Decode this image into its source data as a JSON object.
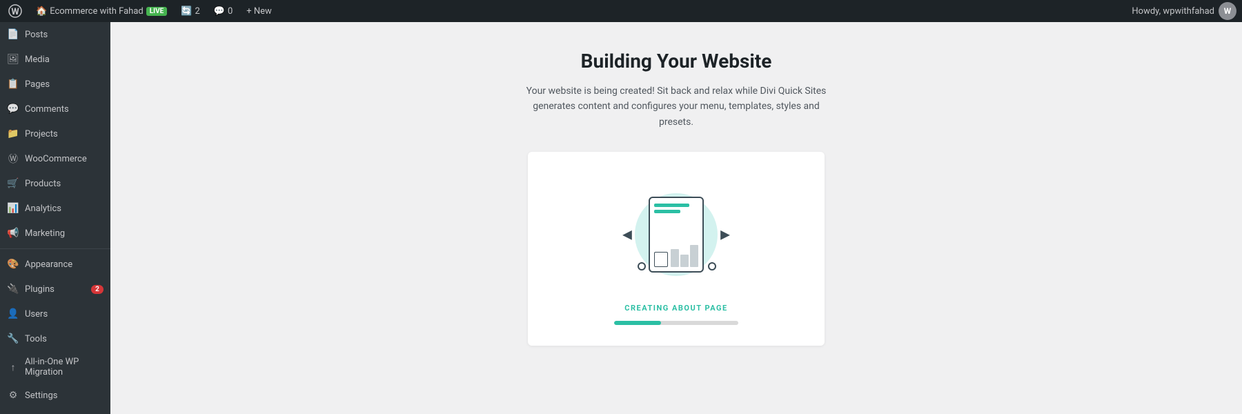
{
  "adminbar": {
    "logo": "⊞",
    "site_name": "Ecommerce with Fahad",
    "live_label": "Live",
    "updates_count": "2",
    "comments_count": "0",
    "new_label": "+ New",
    "howdy_text": "Howdy, wpwithfahad"
  },
  "sidebar": {
    "items": [
      {
        "id": "posts",
        "label": "Posts",
        "icon": "📄",
        "badge": ""
      },
      {
        "id": "media",
        "label": "Media",
        "icon": "🖼",
        "badge": ""
      },
      {
        "id": "pages",
        "label": "Pages",
        "icon": "📋",
        "badge": ""
      },
      {
        "id": "comments",
        "label": "Comments",
        "icon": "💬",
        "badge": ""
      },
      {
        "id": "projects",
        "label": "Projects",
        "icon": "📁",
        "badge": ""
      },
      {
        "id": "woocommerce",
        "label": "WooCommerce",
        "icon": "Ⓦ",
        "badge": ""
      },
      {
        "id": "products",
        "label": "Products",
        "icon": "🛒",
        "badge": ""
      },
      {
        "id": "analytics",
        "label": "Analytics",
        "icon": "📊",
        "badge": ""
      },
      {
        "id": "marketing",
        "label": "Marketing",
        "icon": "📢",
        "badge": ""
      },
      {
        "id": "appearance",
        "label": "Appearance",
        "icon": "🎨",
        "badge": ""
      },
      {
        "id": "plugins",
        "label": "Plugins",
        "icon": "🔌",
        "badge": "2"
      },
      {
        "id": "users",
        "label": "Users",
        "icon": "👤",
        "badge": ""
      },
      {
        "id": "tools",
        "label": "Tools",
        "icon": "🔧",
        "badge": ""
      },
      {
        "id": "allinone",
        "label": "All-in-One WP Migration",
        "icon": "↑",
        "badge": ""
      },
      {
        "id": "settings",
        "label": "Settings",
        "icon": "⚙",
        "badge": ""
      }
    ]
  },
  "main": {
    "title": "Building Your Website",
    "subtitle": "Your website is being created! Sit back and relax while Divi Quick Sites generates content and configures your menu, templates, styles and presets.",
    "card": {
      "status_label": "CREATING ABOUT PAGE",
      "progress_pct": 38
    }
  }
}
